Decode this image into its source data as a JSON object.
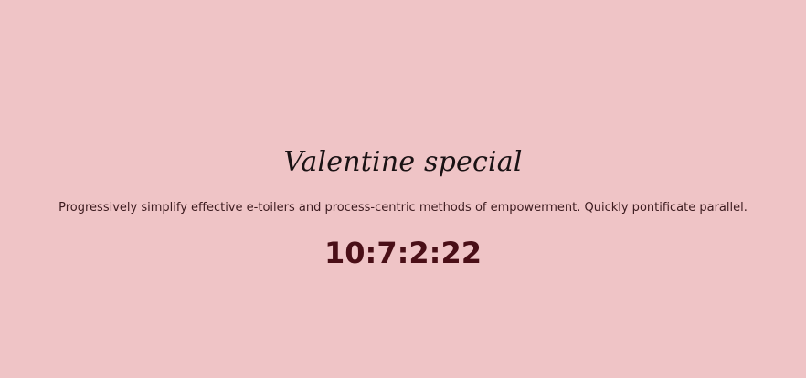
{
  "hero": {
    "title": "Valentine special",
    "description": "Progressively simplify effective e-toilers and process-centric methods of empowerment. Quickly pontificate parallel.",
    "countdown": "10:7:2:22"
  },
  "colors": {
    "background": "#efc4c6",
    "title": "#1a1214",
    "text": "#3c1b1f",
    "countdown": "#4a0f17"
  }
}
